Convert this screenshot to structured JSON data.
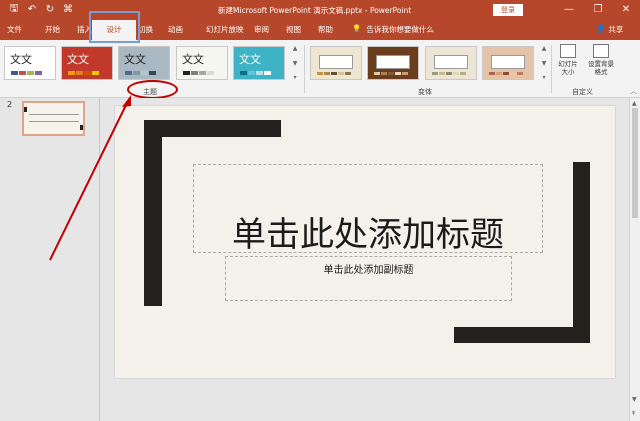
{
  "qat": {
    "save": "🖫",
    "undo": "↶",
    "redo": "↻",
    "start": "⌘"
  },
  "window": {
    "title": "新建Microsoft PowerPoint 演示文稿.pptx - PowerPoint",
    "signin_label": "登录",
    "minimize": "—",
    "restore": "❐",
    "close": "✕"
  },
  "tabs": [
    {
      "label": "文件"
    },
    {
      "label": "开始"
    },
    {
      "label": "插入"
    },
    {
      "label": "设计"
    },
    {
      "label": "切换"
    },
    {
      "label": "动画"
    },
    {
      "label": "幻灯片放映"
    },
    {
      "label": "审阅"
    },
    {
      "label": "视图"
    },
    {
      "label": "帮助"
    }
  ],
  "tell_me": {
    "icon": "lightbulb-icon",
    "glyph": "💡",
    "text": "告诉我你想要做什么"
  },
  "share": {
    "icon": "person-icon",
    "glyph": "👤",
    "label": "共享"
  },
  "ribbon": {
    "themes": [
      {
        "label": "文文",
        "bg": "#ffffff",
        "fg": "#222222",
        "bar": [
          "#3f5c8c",
          "#c0504d",
          "#9bbb59",
          "#8064a2"
        ]
      },
      {
        "label": "文文",
        "bg": "#c0392b",
        "fg": "#ffffff",
        "bar": [
          "#f39c12",
          "#e67e22",
          "#d35400",
          "#f1c40f"
        ]
      },
      {
        "label": "文文",
        "bg": "#aab8c4",
        "fg": "#222222",
        "bar": [
          "#4f6b88",
          "#7f9aa8",
          "#b6c6d1",
          "#34495e"
        ]
      },
      {
        "label": "文文",
        "bg": "#f6f6f0",
        "fg": "#222222",
        "bar": [
          "#222222",
          "#7f7f7f",
          "#a5a5a5",
          "#d8d8d8"
        ]
      },
      {
        "label": "文文",
        "bg": "#3fb3c6",
        "fg": "#ffffff",
        "bar": [
          "#0f6f88",
          "#66c2d6",
          "#b3e0eb",
          "#ffffff"
        ]
      }
    ],
    "scroll_up": "▲",
    "scroll_down": "▼",
    "scroll_more": "▾",
    "group_theme": "主题",
    "variants": [
      {
        "bg": "#efe6d1",
        "bar": [
          "#c8913f",
          "#a58757",
          "#6a4f2f",
          "#d5c2a0",
          "#8b7355"
        ]
      },
      {
        "bg": "#6b3d1f",
        "bar": [
          "#e0c79f",
          "#b08058",
          "#8b5a3c",
          "#f0dcc0",
          "#d39b6a"
        ]
      },
      {
        "bg": "#ede6d6",
        "bar": [
          "#9c9a80",
          "#c8b98e",
          "#8e8a6c",
          "#e0d7b7",
          "#b8ad84"
        ]
      },
      {
        "bg": "#e4c3a8",
        "bar": [
          "#a66a4b",
          "#d99e78",
          "#8b4e30",
          "#f0c6a8",
          "#c27e58"
        ]
      }
    ],
    "group_variant": "变体",
    "slide_size_label": "幻灯片大小",
    "format_bg_label": "设置背景格式",
    "group_customize": "自定义",
    "collapse": "︿"
  },
  "thumbnails": [
    {
      "number": "2"
    }
  ],
  "slide": {
    "title": "单击此处添加标题",
    "subtitle": "单击此处添加副标题"
  },
  "scrollbar": {
    "up": "▲",
    "down": "▼",
    "page_up": "⇞"
  },
  "colors": {
    "accent": "#b7472a",
    "annotation": "#c00000",
    "tab_highlight": "#7a9cd0",
    "slide_shape": "#23211d"
  }
}
